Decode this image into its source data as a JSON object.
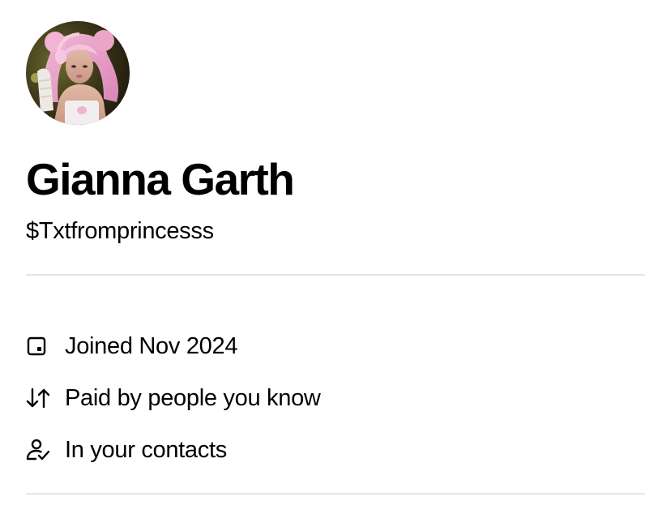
{
  "profile": {
    "display_name": "Gianna Garth",
    "cashtag": "$Txtfromprincesss"
  },
  "details": [
    {
      "icon": "calendar-square-icon",
      "text": "Joined Nov 2024"
    },
    {
      "icon": "transfer-arrows-icon",
      "text": "Paid by people you know"
    },
    {
      "icon": "contact-check-icon",
      "text": "In your contacts"
    }
  ],
  "colors": {
    "text": "#000000",
    "divider": "#e6e6e6",
    "background": "#ffffff"
  }
}
